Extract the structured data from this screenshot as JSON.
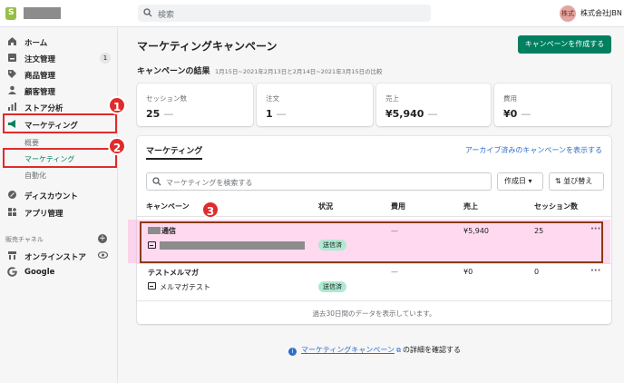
{
  "topbar": {
    "search_placeholder": "検索",
    "avatar_text": "株式",
    "shop_name": "株式会社JBN"
  },
  "sidebar": {
    "items": [
      {
        "label": "ホーム",
        "icon": "home-icon"
      },
      {
        "label": "注文管理",
        "icon": "orders-icon",
        "badge": "1"
      },
      {
        "label": "商品管理",
        "icon": "tag-icon"
      },
      {
        "label": "顧客管理",
        "icon": "person-icon"
      },
      {
        "label": "ストア分析",
        "icon": "bar-chart-icon"
      },
      {
        "label": "マーケティング",
        "icon": "megaphone-icon"
      },
      {
        "label": "ディスカウント",
        "icon": "discount-icon"
      },
      {
        "label": "アプリ管理",
        "icon": "apps-icon"
      }
    ],
    "marketing_sub": [
      "概要",
      "マーケティング",
      "自動化"
    ],
    "channels_label": "販売チャネル",
    "channels": [
      {
        "label": "オンラインストア",
        "icon": "store-icon"
      },
      {
        "label": "Google",
        "icon": "google-icon"
      }
    ]
  },
  "annotations": [
    "1",
    "2",
    "3"
  ],
  "page": {
    "title": "マーケティングキャンペーン",
    "create_button": "キャンペーンを作成する",
    "results_title": "キャンペーンの結果",
    "results_sub": "1月15日~2021年2月13日と2月14日~2021年3月15日の比較"
  },
  "stats": [
    {
      "label": "セッション数",
      "value": "25",
      "delta": "—"
    },
    {
      "label": "注文",
      "value": "1",
      "delta": "—"
    },
    {
      "label": "売上",
      "value": "¥5,940",
      "delta": "—"
    },
    {
      "label": "費用",
      "value": "¥0",
      "delta": "—"
    }
  ],
  "campaigns": {
    "tab": "マーケティング",
    "archive_link": "アーカイブ済みのキャンペーンを表示する",
    "search_placeholder": "マーケティングを検索する",
    "date_button": "作成日",
    "sort_button": "並び替え",
    "columns": [
      "キャンペーン",
      "状況",
      "費用",
      "売上",
      "セッション数"
    ],
    "rows": [
      {
        "name": "通信",
        "activity": "",
        "status": "送信済",
        "cost": "—",
        "sales": "¥5,940",
        "sessions": "25"
      },
      {
        "name": "テストメルマガ",
        "activity": "メルマガテスト",
        "status": "送信済",
        "cost": "—",
        "sales": "¥0",
        "sessions": "0"
      }
    ],
    "footer": "過去30日間のデータを表示しています。"
  },
  "info": {
    "link": "マーケティングキャンペーン",
    "suffix": "の詳細を確認する"
  },
  "colors": {
    "primary": "#008060",
    "annotation": "#e02b2b",
    "link": "#2c6ecb",
    "badge": "#aee9d1"
  }
}
